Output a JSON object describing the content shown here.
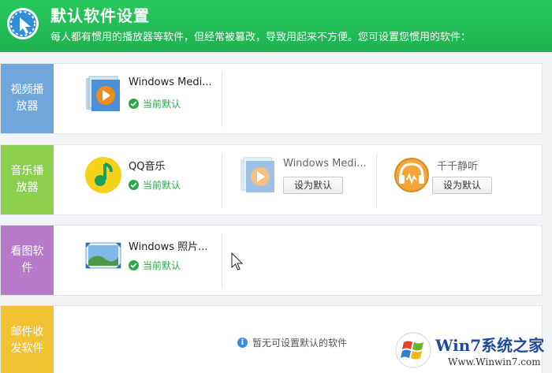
{
  "header": {
    "title": "默认软件设置",
    "description": "每人都有惯用的播放器等软件，但经常被篡改，导致用起来不方便。您可设置您惯用的软件："
  },
  "colors": {
    "header_green": "#22bf58",
    "video": "#6fa6dc",
    "music": "#8ccf4d",
    "image": "#b57ac8",
    "mail": "#f2c233",
    "default_green": "#2aa846"
  },
  "rows": [
    {
      "category": "视频播放器",
      "items": [
        {
          "name": "Windows Medi...",
          "icon": "media-player-icon",
          "status": "当前默认"
        }
      ]
    },
    {
      "category": "音乐播放器",
      "items": [
        {
          "name": "QQ音乐",
          "icon": "qq-music-icon",
          "status": "当前默认"
        },
        {
          "name": "Windows Medi...",
          "icon": "media-player-icon",
          "button": "设为默认"
        },
        {
          "name": "千千静听",
          "icon": "ttplayer-icon",
          "button": "设为默认"
        }
      ]
    },
    {
      "category": "看图软件",
      "items": [
        {
          "name": "Windows 照片...",
          "icon": "photo-viewer-icon",
          "status": "当前默认"
        }
      ]
    },
    {
      "category": "邮件收发软件",
      "empty_message": "暂无可设置默认的软件"
    }
  ],
  "watermark": {
    "brand": "Win7系统之家",
    "url": "Www.Winwin7.com"
  }
}
